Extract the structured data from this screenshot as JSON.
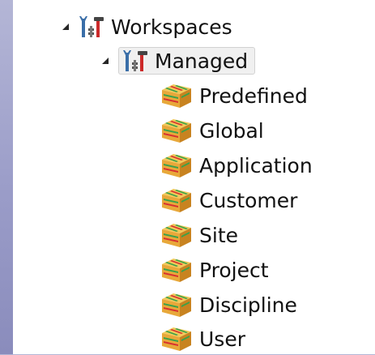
{
  "tree": {
    "root": {
      "label": "Workspaces",
      "icon": "workspace-tools-icon",
      "expanded": true
    },
    "managed": {
      "label": "Managed",
      "icon": "workspace-tools-icon",
      "expanded": true,
      "selected": true
    },
    "children": [
      {
        "label": "Predefined",
        "icon": "package-box-icon"
      },
      {
        "label": "Global",
        "icon": "package-box-icon"
      },
      {
        "label": "Application",
        "icon": "package-box-icon"
      },
      {
        "label": "Customer",
        "icon": "package-box-icon"
      },
      {
        "label": "Site",
        "icon": "package-box-icon"
      },
      {
        "label": "Project",
        "icon": "package-box-icon"
      },
      {
        "label": "Discipline",
        "icon": "package-box-icon"
      },
      {
        "label": "User",
        "icon": "package-box-icon"
      }
    ]
  },
  "colors": {
    "selection_bg": "#f0f0f0",
    "box_orange": "#e8a83a",
    "box_green": "#3aa24a",
    "box_red": "#d83030",
    "tool_red": "#cc2a2a",
    "tool_blue": "#3a6ea8"
  }
}
